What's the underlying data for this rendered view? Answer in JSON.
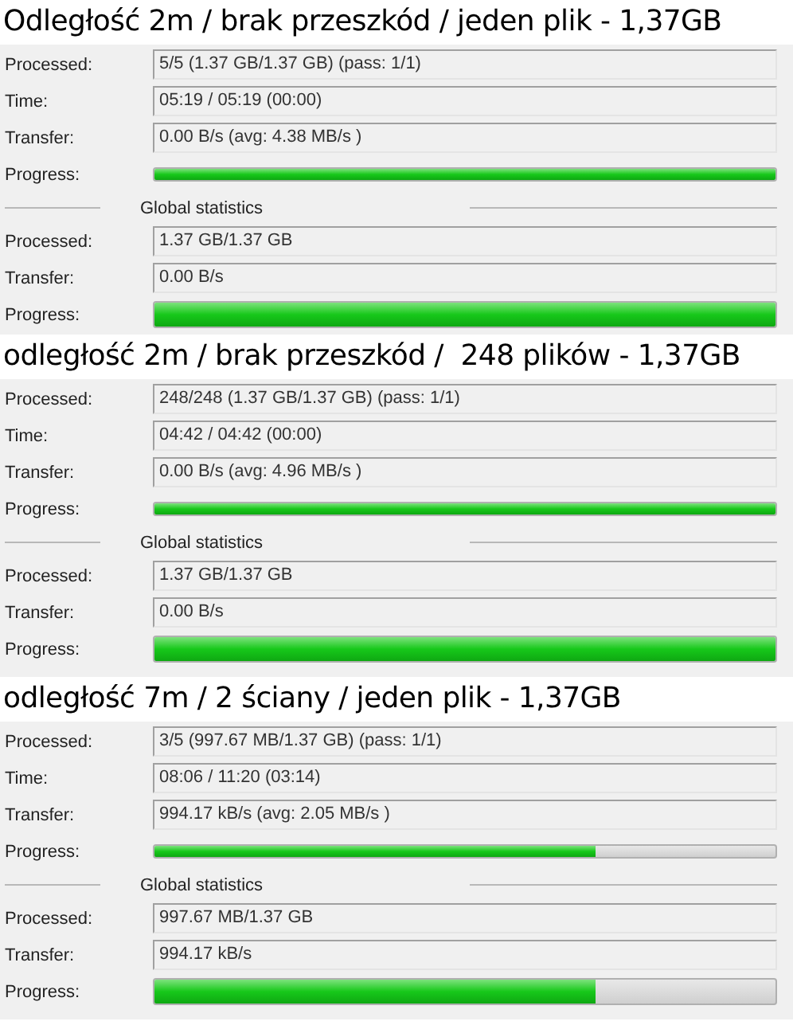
{
  "sections": [
    {
      "title": "Odległość 2m / brak przeszkód / jeden plik - 1,37GB",
      "rows": [
        {
          "label": "Processed:",
          "value": "5/5 (1.37 GB/1.37 GB) (pass: 1/1)"
        },
        {
          "label": "Time:",
          "value": "05:19 / 05:19 (00:00)"
        },
        {
          "label": "Transfer:",
          "value": "0.00 B/s (avg: 4.38 MB/s )"
        }
      ],
      "progress": {
        "label": "Progress:",
        "level": 1
      },
      "global": {
        "heading": "Global statistics",
        "rows": [
          {
            "label": "Processed:",
            "value": "1.37 GB/1.37 GB"
          },
          {
            "label": "Transfer:",
            "value": "0.00 B/s"
          }
        ],
        "progress": {
          "label": "Progress:",
          "level": 1
        }
      }
    },
    {
      "title": "odległość 2m / brak przeszkód /  248 plików - 1,37GB",
      "rows": [
        {
          "label": "Processed:",
          "value": "248/248 (1.37 GB/1.37 GB) (pass: 1/1)"
        },
        {
          "label": "Time:",
          "value": "04:42 / 04:42 (00:00)"
        },
        {
          "label": "Transfer:",
          "value": "0.00 B/s (avg: 4.96 MB/s )"
        }
      ],
      "progress": {
        "label": "Progress:",
        "level": 1
      },
      "global": {
        "heading": "Global statistics",
        "rows": [
          {
            "label": "Processed:",
            "value": "1.37 GB/1.37 GB"
          },
          {
            "label": "Transfer:",
            "value": "0.00 B/s"
          }
        ],
        "progress": {
          "label": "Progress:",
          "level": 1
        }
      }
    },
    {
      "title": "odległość 7m / 2 ściany / jeden plik - 1,37GB",
      "rows": [
        {
          "label": "Processed:",
          "value": "3/5 (997.67 MB/1.37 GB) (pass: 1/1)"
        },
        {
          "label": "Time:",
          "value": "08:06 / 11:20 (03:14)"
        },
        {
          "label": "Transfer:",
          "value": "994.17 kB/s (avg: 2.05 MB/s )"
        }
      ],
      "progress": {
        "label": "Progress:",
        "level": 0.71
      },
      "global": {
        "heading": "Global statistics",
        "rows": [
          {
            "label": "Processed:",
            "value": "997.67 MB/1.37 GB"
          },
          {
            "label": "Transfer:",
            "value": "994.17 kB/s"
          }
        ],
        "progress": {
          "label": "Progress:",
          "level": 0.71
        }
      }
    }
  ]
}
